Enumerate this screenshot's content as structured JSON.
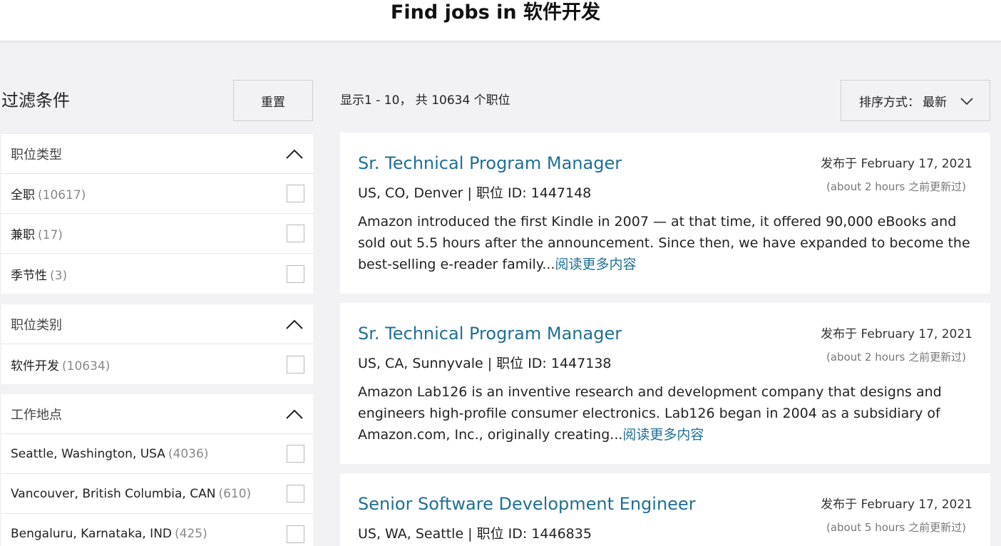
{
  "page": {
    "title": "Find jobs in 软件开发"
  },
  "filters": {
    "heading": "过滤条件",
    "reset_label": "重置",
    "groups": [
      {
        "title": "职位类型",
        "items": [
          {
            "label": "全职",
            "count": "(10617)"
          },
          {
            "label": "兼职",
            "count": "(17)"
          },
          {
            "label": "季节性",
            "count": "(3)"
          }
        ]
      },
      {
        "title": "职位类别",
        "items": [
          {
            "label": "软件开发",
            "count": "(10634)"
          }
        ]
      },
      {
        "title": "工作地点",
        "items": [
          {
            "label": "Seattle, Washington, USA",
            "count": "(4036)"
          },
          {
            "label": "Vancouver, British Columbia, CAN",
            "count": "(610)"
          },
          {
            "label": "Bengaluru, Karnataka, IND",
            "count": "(425)"
          }
        ]
      }
    ]
  },
  "results": {
    "summary": "显示1 - 10， 共 10634 个职位",
    "sort": {
      "label": "排序方式：",
      "value": "最新"
    },
    "jobs": [
      {
        "title": "Sr. Technical Program Manager",
        "location": "US, CO, Denver | 职位 ID: 1447148",
        "posted": "发布于 February 17, 2021",
        "updated": "(about 2 hours 之前更新过)",
        "description": "Amazon introduced the first Kindle in 2007 — at that time, it offered 90,000 eBooks and sold out 5.5 hours after the announcement. Since then, we have expanded to become the best-selling e-reader family...",
        "read_more": "阅读更多内容"
      },
      {
        "title": "Sr. Technical Program Manager",
        "location": "US, CA, Sunnyvale | 职位 ID: 1447138",
        "posted": "发布于 February 17, 2021",
        "updated": "(about 2 hours 之前更新过)",
        "description": "Amazon Lab126 is an inventive research and development company that designs and engineers high-profile consumer electronics. Lab126 began in 2004 as a subsidiary of Amazon.com, Inc., originally creating...",
        "read_more": "阅读更多内容"
      },
      {
        "title": "Senior Software Development Engineer",
        "location": "US, WA, Seattle | 职位 ID: 1446835",
        "posted": "发布于 February 17, 2021",
        "updated": "(about 5 hours 之前更新过)"
      }
    ]
  },
  "icons": {
    "collapse": "chevron-up-icon",
    "sort": "chevron-down-icon"
  }
}
